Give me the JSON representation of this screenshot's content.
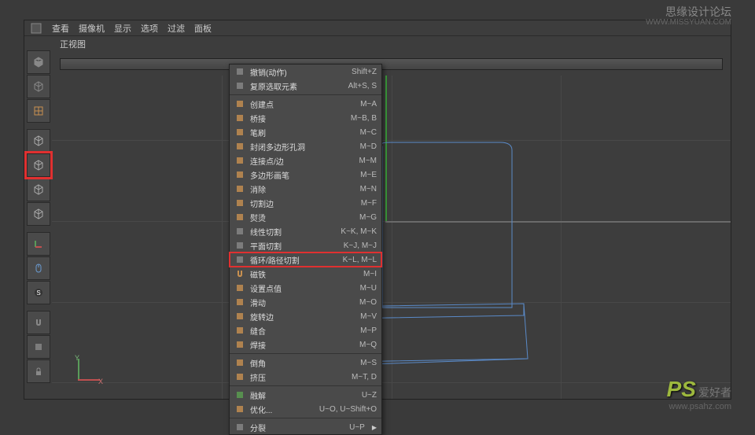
{
  "watermarks": {
    "top_text": "思缘设计论坛",
    "top_url": "WWW.MISSYUAN.COM",
    "bottom_logo": "PS",
    "bottom_text": "爱好者",
    "bottom_url": "www.psahz.com"
  },
  "top_menu": {
    "items": [
      "查看",
      "摄像机",
      "显示",
      "选项",
      "过滤",
      "面板"
    ]
  },
  "view_label": "正视图",
  "gizmo": {
    "y_label": "Y",
    "x_label": "X"
  },
  "left_tools": [
    {
      "name": "cube-solid-icon",
      "color": "#888"
    },
    {
      "name": "cube-checker-icon",
      "color": "#888"
    },
    {
      "name": "grid-icon",
      "color": "#c89050"
    },
    {
      "name": "cube-outline-icon",
      "color": "#aaa"
    },
    {
      "name": "cube-model-icon",
      "color": "#aaa",
      "highlighted": true
    },
    {
      "name": "cube-point-icon",
      "color": "#aaa"
    },
    {
      "name": "cube-edge-icon",
      "color": "#aaa"
    },
    {
      "name": "axis-icon",
      "color": "#c89050"
    },
    {
      "name": "mouse-icon",
      "color": "#6a9ad0"
    },
    {
      "name": "snap-icon",
      "color": "#333"
    },
    {
      "name": "magnet-icon",
      "color": "#888"
    },
    {
      "name": "workplane-icon",
      "color": "#888"
    },
    {
      "name": "lock-icon",
      "color": "#888"
    }
  ],
  "context_menu": [
    {
      "icon": "undo-icon",
      "color": "#888",
      "label": "撤销(动作)",
      "shortcut": "Shift+Z"
    },
    {
      "icon": "reset-icon",
      "color": "#888",
      "label": "复原选取元素",
      "shortcut": "Alt+S, S"
    },
    {
      "divider": true
    },
    {
      "icon": "point-icon",
      "color": "#c89050",
      "label": "创建点",
      "shortcut": "M~A"
    },
    {
      "icon": "bridge-icon",
      "color": "#c89050",
      "label": "桥接",
      "shortcut": "M~B, B"
    },
    {
      "icon": "brush-icon",
      "color": "#c89050",
      "label": "笔刷",
      "shortcut": "M~C"
    },
    {
      "icon": "close-hole-icon",
      "color": "#c89050",
      "label": "封闭多边形孔洞",
      "shortcut": "M~D"
    },
    {
      "icon": "connect-icon",
      "color": "#c89050",
      "label": "连接点/边",
      "shortcut": "M~M"
    },
    {
      "icon": "poly-pen-icon",
      "color": "#c89050",
      "label": "多边形画笔",
      "shortcut": "M~E"
    },
    {
      "icon": "dissolve-icon",
      "color": "#c89050",
      "label": "消除",
      "shortcut": "M~N"
    },
    {
      "icon": "cut-edge-icon",
      "color": "#c89050",
      "label": "切割边",
      "shortcut": "M~F"
    },
    {
      "icon": "iron-icon",
      "color": "#c89050",
      "label": "熨烫",
      "shortcut": "M~G"
    },
    {
      "icon": "line-cut-icon",
      "color": "#888",
      "label": "线性切割",
      "shortcut": "K~K, M~K"
    },
    {
      "icon": "plane-cut-icon",
      "color": "#888",
      "label": "平面切割",
      "shortcut": "K~J, M~J"
    },
    {
      "icon": "loop-cut-icon",
      "color": "#888",
      "label": "循环/路径切割",
      "shortcut": "K~L, M~L",
      "highlighted": true
    },
    {
      "icon": "magnet-icon",
      "color": "#c89050",
      "label": "磁铁",
      "shortcut": "M~I"
    },
    {
      "icon": "set-value-icon",
      "color": "#c89050",
      "label": "设置点值",
      "shortcut": "M~U"
    },
    {
      "icon": "slide-icon",
      "color": "#c89050",
      "label": "滑动",
      "shortcut": "M~O"
    },
    {
      "icon": "spin-edge-icon",
      "color": "#c89050",
      "label": "旋转边",
      "shortcut": "M~V"
    },
    {
      "icon": "stitch-icon",
      "color": "#c89050",
      "label": "缝合",
      "shortcut": "M~P"
    },
    {
      "icon": "weld-icon",
      "color": "#c89050",
      "label": "焊接",
      "shortcut": "M~Q"
    },
    {
      "divider": true
    },
    {
      "icon": "bevel-icon",
      "color": "#c89050",
      "label": "倒角",
      "shortcut": "M~S"
    },
    {
      "icon": "extrude-icon",
      "color": "#c89050",
      "label": "挤压",
      "shortcut": "M~T, D"
    },
    {
      "divider": true
    },
    {
      "icon": "dissolve2-icon",
      "color": "#5aa050",
      "label": "融解",
      "shortcut": "U~Z"
    },
    {
      "icon": "optimize-icon",
      "color": "#c89050",
      "label": "优化...",
      "shortcut": "U~O, U~Shift+O"
    },
    {
      "divider": true
    },
    {
      "icon": "split-icon",
      "color": "#888",
      "label": "分裂",
      "shortcut": "U~P",
      "arrow": true
    }
  ]
}
